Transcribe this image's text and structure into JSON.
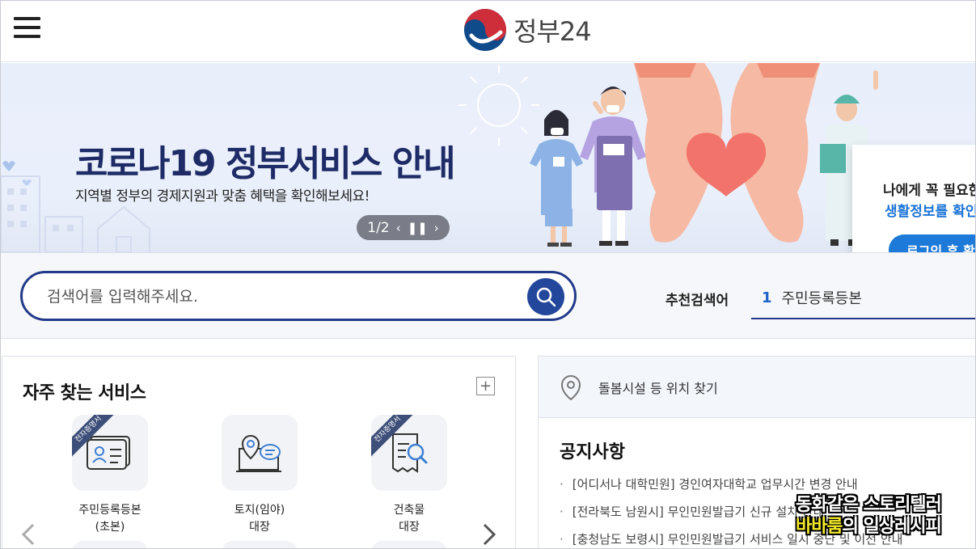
{
  "header": {
    "logo_text": "정부24",
    "colors": {
      "taeguk_red": "#cd2e3a",
      "taeguk_blue": "#0f4a8a"
    }
  },
  "banner": {
    "title": "코로나19 정부서비스 안내",
    "subtitle": "지역별 정부의 경제지원과 맞춤 혜택을 확인해보세요!",
    "pager": "1/2",
    "login_card": {
      "line1": "나에게 꼭 필요한",
      "line2": "생활정보를 확인",
      "button": "로그인 후 확"
    }
  },
  "search": {
    "placeholder": "검색어를 입력해주세요.",
    "recommend_label": "추천검색어",
    "recommend_rank": "1",
    "recommend_term": "주민등록등본"
  },
  "frequent": {
    "title": "자주 찾는 서비스",
    "plus": "+",
    "items": [
      {
        "ribbon": "전자증명서",
        "line1": "주민등록등본",
        "line2": "(초본)"
      },
      {
        "ribbon": "",
        "line1": "토지(임야)",
        "line2": "대장"
      },
      {
        "ribbon": "전자증명서",
        "line1": "건축물",
        "line2": "대장"
      }
    ]
  },
  "location": {
    "text": "돌봄시설 등 위치 찾기"
  },
  "notice": {
    "title": "공지사항",
    "items": [
      "[어디서나 대학민원] 경인여자대학교 업무시간 변경 안내",
      "[전라북도 남원시] 무인민원발급기 신규 설치 안내",
      "[충청남도 보령시] 무인민원발급기 서비스 일시 중단 및 이전 안내"
    ]
  },
  "watermark": {
    "line1": "동화같은 스토리텔러",
    "line2a": "바바룸",
    "line2b": "의 일상레시피"
  }
}
